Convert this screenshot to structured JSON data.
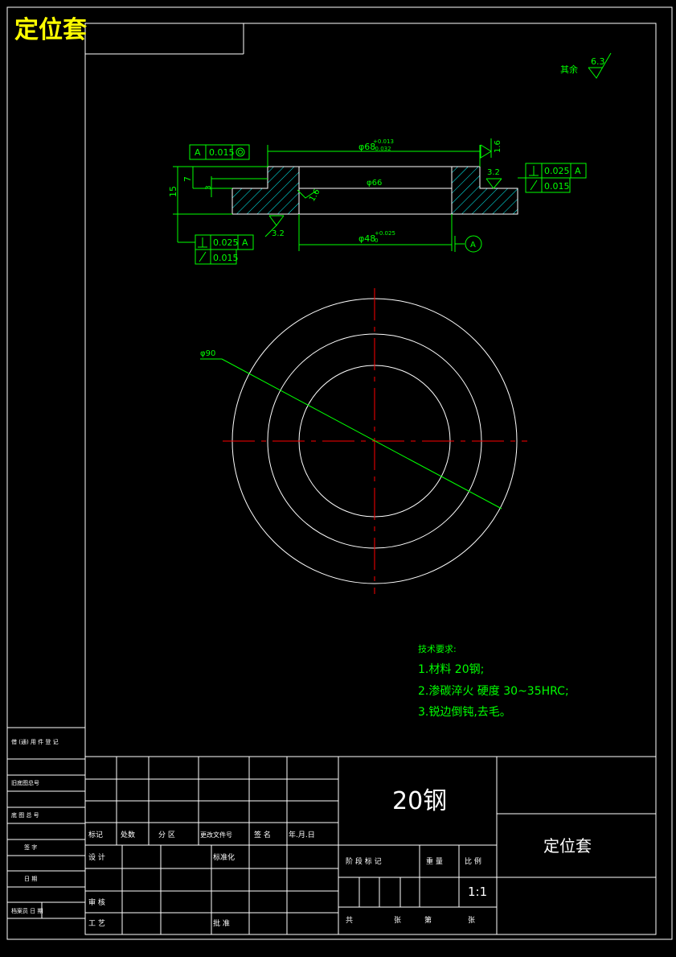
{
  "title": "定位套",
  "surface_finish": {
    "label": "其余",
    "value": "6.3"
  },
  "dimensions": {
    "outer_top_dia": "φ68",
    "outer_top_tol_upper": "+0.013",
    "outer_top_tol_lower": "-0.032",
    "mid_dia": "φ66",
    "inner_dia": "φ48",
    "inner_tol_upper": "+0.025",
    "inner_tol_lower": "0",
    "height_total": "15",
    "height_step": "7",
    "height_small": "3",
    "circle_dia": "φ90",
    "rough_top_right": "1.6",
    "rough_left": "1.6",
    "rough_right": "3.2",
    "rough_bottom": "3.2",
    "datum": "A"
  },
  "tolerance_frames": {
    "concentric": {
      "value": "0.015",
      "datum": "A"
    },
    "right_perp": {
      "value": "0.025",
      "datum": "A"
    },
    "right_runout": {
      "value": "0.015"
    },
    "left_perp": {
      "value": "0.025",
      "datum": "A"
    },
    "left_runout": {
      "value": "0.015"
    }
  },
  "tech_notes": {
    "heading": "技术要求:",
    "items": [
      "1.材料 20钢;",
      "2.渗碳淬火 硬度 30~35HRC;",
      "3.锐边倒钝,去毛。"
    ]
  },
  "left_strip": {
    "cells": [
      "借 (通) 用 件 登 记",
      "旧底图总号",
      "底 图 总 号",
      "签 字",
      "日 期",
      "档案员 日 期"
    ]
  },
  "title_block": {
    "material": "20钢",
    "part_name": "定位套",
    "scale": "1:1",
    "header": [
      "标记",
      "处数",
      "分 区",
      "更改文件号",
      "签 名",
      "年.月.日"
    ],
    "design": "设 计",
    "standardization": "标准化",
    "review": "审 核",
    "process": "工 艺",
    "approve": "批 准",
    "stage_mark": "阶 段 标 记",
    "weight": "重 量",
    "scale_label": "比 例",
    "sheets_total": "共",
    "sheets_total_unit": "张",
    "sheet_no": "第",
    "sheet_no_unit": "张"
  }
}
